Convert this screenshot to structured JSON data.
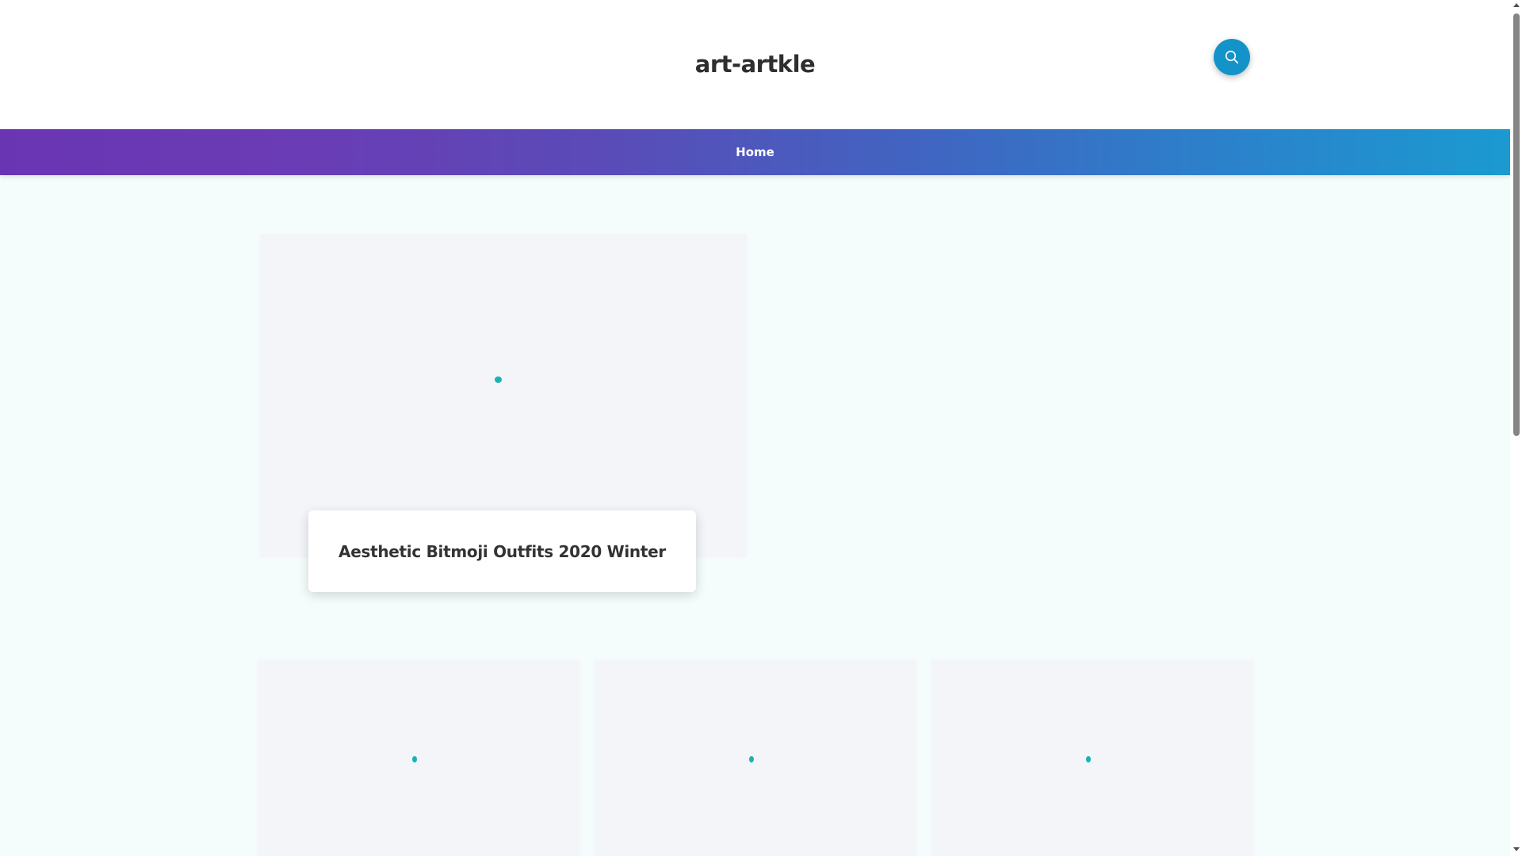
{
  "site": {
    "title": "art-artkle"
  },
  "header": {
    "search_icon": "search-icon",
    "accent_color": "#1493c8"
  },
  "nav": {
    "items": [
      {
        "label": "Home"
      }
    ],
    "gradient": [
      "#6a35b3",
      "#1b9ad0"
    ]
  },
  "featured_post": {
    "title": "Aesthetic Bitmoji Outfits 2020 Winter",
    "image_state": "loading"
  },
  "grid_posts": [
    {
      "image_state": "loading"
    },
    {
      "image_state": "loading"
    },
    {
      "image_state": "loading"
    }
  ],
  "colors": {
    "page_background": "#f4fdfc",
    "placeholder_background": "#f3f5f8",
    "loader": "#1ab3b5"
  }
}
